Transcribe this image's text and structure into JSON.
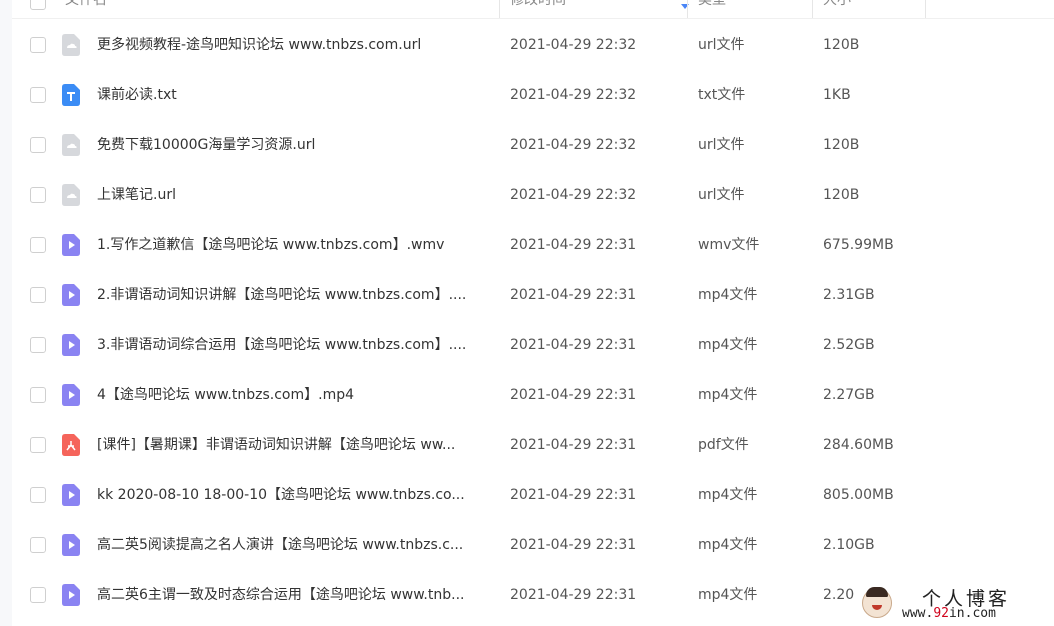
{
  "header": {
    "name": "文件名",
    "time": "修改时间",
    "type": "类型",
    "size": "大小"
  },
  "colors": {
    "url_icon": "#d6d8dc",
    "txt_icon": "#3b8cf5",
    "video_icon": "#8a83f2",
    "pdf_icon": "#f5645b",
    "sort_accent": "#4a86f7"
  },
  "files": [
    {
      "icon": "url-file-icon",
      "name": "更多视频教程-途鸟吧知识论坛 www.tnbzs.com.url",
      "time": "2021-04-29 22:32",
      "type": "url文件",
      "size": "120B"
    },
    {
      "icon": "txt-file-icon",
      "name": "课前必读.txt",
      "time": "2021-04-29 22:32",
      "type": "txt文件",
      "size": "1KB"
    },
    {
      "icon": "url-file-icon",
      "name": "免费下载10000G海量学习资源.url",
      "time": "2021-04-29 22:32",
      "type": "url文件",
      "size": "120B"
    },
    {
      "icon": "url-file-icon",
      "name": "上课笔记.url",
      "time": "2021-04-29 22:32",
      "type": "url文件",
      "size": "120B"
    },
    {
      "icon": "video-file-icon",
      "name": "1.写作之道歉信【途鸟吧论坛 www.tnbzs.com】.wmv",
      "time": "2021-04-29 22:31",
      "type": "wmv文件",
      "size": "675.99MB"
    },
    {
      "icon": "video-file-icon",
      "name": "2.非谓语动词知识讲解【途鸟吧论坛 www.tnbzs.com】....",
      "time": "2021-04-29 22:31",
      "type": "mp4文件",
      "size": "2.31GB"
    },
    {
      "icon": "video-file-icon",
      "name": "3.非谓语动词综合运用【途鸟吧论坛 www.tnbzs.com】....",
      "time": "2021-04-29 22:31",
      "type": "mp4文件",
      "size": "2.52GB"
    },
    {
      "icon": "video-file-icon",
      "name": "4【途鸟吧论坛 www.tnbzs.com】.mp4",
      "time": "2021-04-29 22:31",
      "type": "mp4文件",
      "size": "2.27GB"
    },
    {
      "icon": "pdf-file-icon",
      "name": "[课件]【暑期课】非谓语动词知识讲解【途鸟吧论坛 ww...",
      "time": "2021-04-29 22:31",
      "type": "pdf文件",
      "size": "284.60MB"
    },
    {
      "icon": "video-file-icon",
      "name": "kk 2020-08-10 18-00-10【途鸟吧论坛 www.tnbzs.co...",
      "time": "2021-04-29 22:31",
      "type": "mp4文件",
      "size": "805.00MB"
    },
    {
      "icon": "video-file-icon",
      "name": "高二英5阅读提高之名人演讲【途鸟吧论坛 www.tnbzs.c...",
      "time": "2021-04-29 22:31",
      "type": "mp4文件",
      "size": "2.10GB"
    },
    {
      "icon": "video-file-icon",
      "name": "高二英6主谓一致及时态综合运用【途鸟吧论坛 www.tnb...",
      "time": "2021-04-29 22:31",
      "type": "mp4文件",
      "size": "2.20"
    }
  ],
  "watermark": {
    "title": "个人博客",
    "url_prefix": "www.",
    "url_highlight": "92",
    "url_suffix": "in.com"
  }
}
